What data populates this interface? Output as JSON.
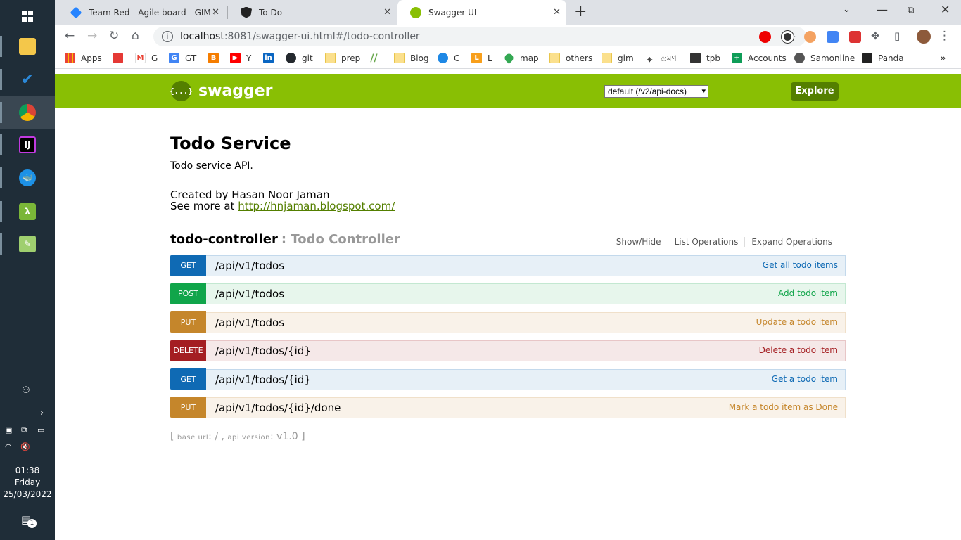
{
  "taskbar": {
    "clock_time": "01:38",
    "clock_day": "Friday",
    "clock_date": "25/03/2022",
    "notification_count": "1"
  },
  "tabs": [
    {
      "title": "Team Red - Agile board - GIM En",
      "icon": "jira-icon",
      "color": "#2684ff"
    },
    {
      "title": "To Do",
      "icon": "angular-icon",
      "color": "#222222"
    },
    {
      "title": "Swagger UI",
      "icon": "swagger-icon",
      "color": "#89bf04",
      "active": true
    }
  ],
  "browser": {
    "url_host": "localhost",
    "url_rest": ":8081/swagger-ui.html#/todo-controller"
  },
  "bookmarks": [
    {
      "label": "Apps",
      "icon": "apps-grid-icon"
    },
    {
      "label": "অ",
      "icon": "bengali-icon"
    },
    {
      "label": "G",
      "icon": "gmail-icon"
    },
    {
      "label": "GT",
      "icon": "translate-icon"
    },
    {
      "label": "",
      "icon": "blogger-icon"
    },
    {
      "label": "Y",
      "icon": "youtube-icon"
    },
    {
      "label": "",
      "icon": "linkedin-icon"
    },
    {
      "label": "git",
      "icon": "github-icon"
    },
    {
      "label": "prep",
      "icon": "folder-icon"
    },
    {
      "label": "",
      "icon": "slash-icon"
    },
    {
      "label": "Blog",
      "icon": "folder-icon"
    },
    {
      "label": "C",
      "icon": "codeforces-icon"
    },
    {
      "label": "L",
      "icon": "leetcode-icon"
    },
    {
      "label": "map",
      "icon": "maps-icon"
    },
    {
      "label": "others",
      "icon": "folder-icon"
    },
    {
      "label": "gim",
      "icon": "folder-icon"
    },
    {
      "label": "ভ্রমণ",
      "icon": "location-pin-icon"
    },
    {
      "label": "tpb",
      "icon": "ship-icon"
    },
    {
      "label": "Accounts",
      "icon": "sheets-icon"
    },
    {
      "label": "Samonline",
      "icon": "globe-icon"
    },
    {
      "label": "Panda",
      "icon": "panda-icon"
    }
  ],
  "swagger": {
    "brand": "swagger",
    "logo_glyph": "{...}",
    "spec_select": "default (/v2/api-docs)",
    "explore_label": "Explore",
    "title": "Todo Service",
    "description": "Todo service API.",
    "created_by": "Created by Hasan Noor Jaman",
    "see_more_prefix": "See more at ",
    "see_more_link": "http://hnjaman.blogspot.com/",
    "controller_name": "todo-controller",
    "controller_desc": ": Todo Controller",
    "links": {
      "show_hide": "Show/Hide",
      "list_ops": "List Operations",
      "expand_ops": "Expand Operations"
    },
    "operations": [
      {
        "method": "GET",
        "path": "/api/v1/todos",
        "summary": "Get all todo items"
      },
      {
        "method": "POST",
        "path": "/api/v1/todos",
        "summary": "Add todo item"
      },
      {
        "method": "PUT",
        "path": "/api/v1/todos",
        "summary": "Update a todo item"
      },
      {
        "method": "DELETE",
        "path": "/api/v1/todos/{id}",
        "summary": "Delete a todo item"
      },
      {
        "method": "GET",
        "path": "/api/v1/todos/{id}",
        "summary": "Get a todo item"
      },
      {
        "method": "PUT",
        "path": "/api/v1/todos/{id}/done",
        "summary": "Mark a todo item as Done"
      }
    ],
    "footer": {
      "open": "[ ",
      "base_url_label": "base url",
      "base_url_value": ": / , ",
      "api_version_label": "api version",
      "api_version_value": ": v1.0 ]"
    }
  }
}
